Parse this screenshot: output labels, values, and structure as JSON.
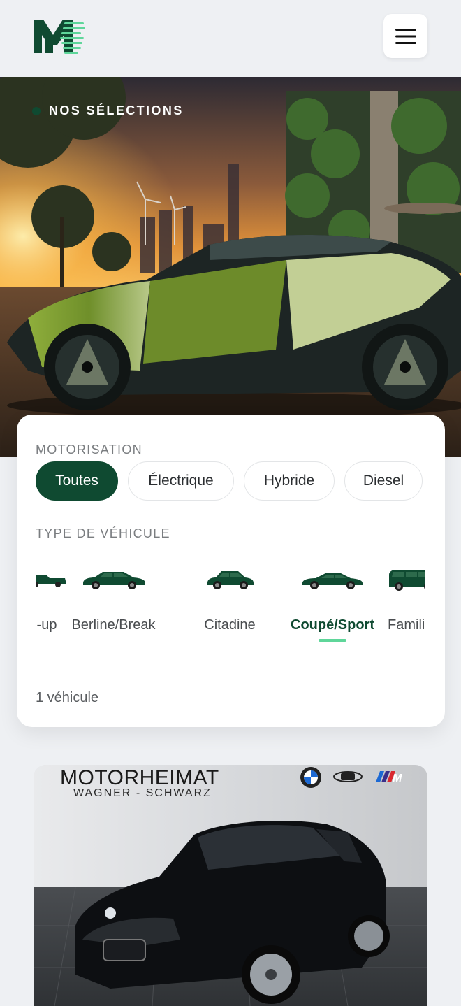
{
  "header": {
    "logo_icon": "motorheimat-m-logo",
    "menu_icon": "hamburger-menu-icon"
  },
  "hero": {
    "label": "NOS SÉLECTIONS"
  },
  "filters": {
    "motorisation_title": "MOTORISATION",
    "motorisation_options": [
      "Toutes",
      "Électrique",
      "Hybride",
      "Diesel"
    ],
    "motorisation_selected": "Toutes",
    "type_title": "TYPE DE VÉHICULE",
    "vehicle_types": [
      "Pick-up",
      "Berline/Break",
      "Citadine",
      "Coupé/Sport",
      "Familiale"
    ],
    "vehicle_types_visible": [
      "-up",
      "Berline/Break",
      "Citadine",
      "Coupé/Sport",
      "Famili"
    ],
    "type_selected": "Coupé/Sport",
    "result_count": "1 véhicule"
  },
  "listing": {
    "dealer_name": "MOTORHEIMAT",
    "dealer_subtitle": "WAGNER - SCHWARZ",
    "brand_icons": [
      "bmw-logo-icon",
      "mini-logo-icon",
      "bmw-m-logo-icon"
    ]
  },
  "colors": {
    "brand_green": "#0f4a31",
    "accent_green": "#5fd69a",
    "background": "#eef0f3"
  }
}
